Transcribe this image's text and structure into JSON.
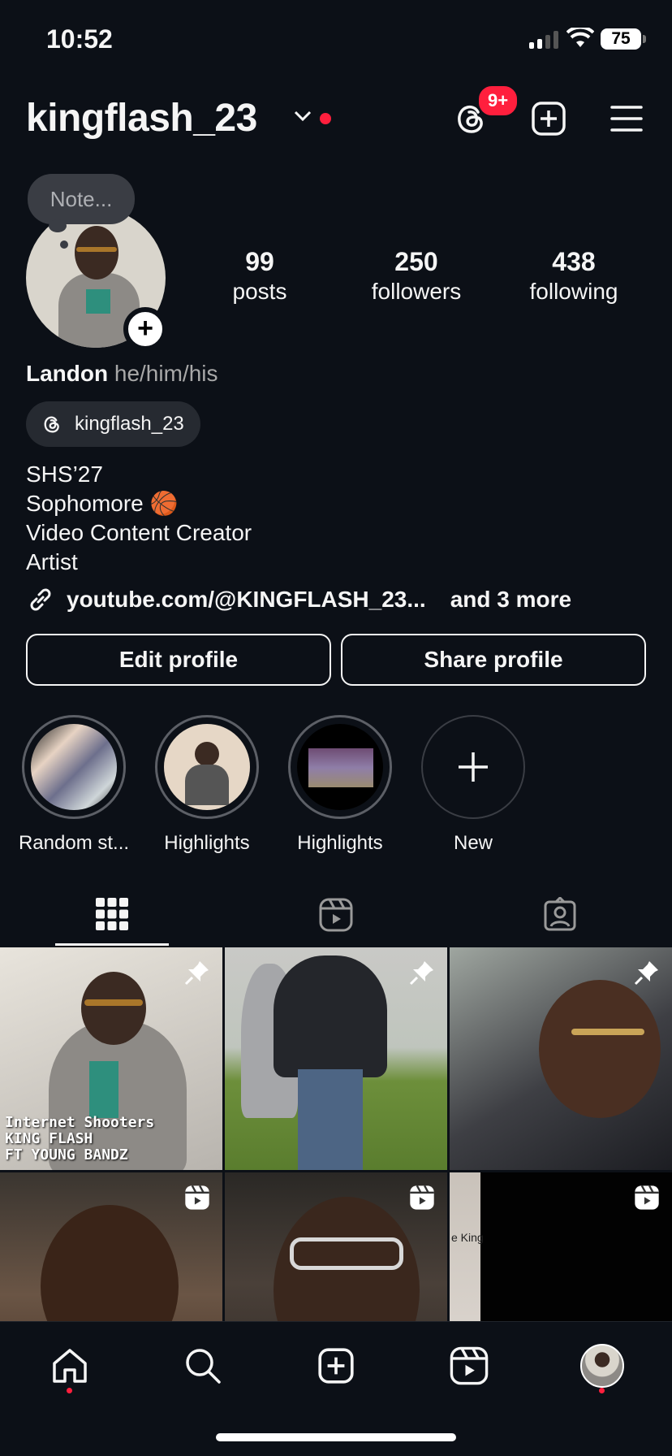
{
  "status_bar": {
    "time": "10:52",
    "battery": "75"
  },
  "header": {
    "username": "kingflash_23",
    "threads_badge": "9+"
  },
  "profile": {
    "note_placeholder": "Note...",
    "stats": [
      {
        "number": "99",
        "label": "posts"
      },
      {
        "number": "250",
        "label": "followers"
      },
      {
        "number": "438",
        "label": "following"
      }
    ],
    "name": "Landon",
    "pronouns": "he/him/his",
    "threads_handle": "kingflash_23",
    "bio_lines": [
      "SHS’27",
      "Sophomore 🏀",
      "Video Content Creator",
      "Artist"
    ],
    "link": "youtube.com/@KINGFLASH_23...",
    "link_more": "and 3 more"
  },
  "buttons": {
    "edit": "Edit profile",
    "share": "Share profile"
  },
  "highlights": [
    {
      "label": "Random st..."
    },
    {
      "label": "Highlights"
    },
    {
      "label": "Highlights"
    },
    {
      "label": "New"
    }
  ],
  "grid": {
    "post1_overlay": [
      "Internet Shooters",
      "KING FLASH",
      "FT YOUNG BANDZ"
    ],
    "post6_side": "e King"
  },
  "colors": {
    "background": "#0c1017",
    "accent_red": "#ff1f3d",
    "text": "#f5f5f5",
    "muted": "#a8a8a8"
  }
}
